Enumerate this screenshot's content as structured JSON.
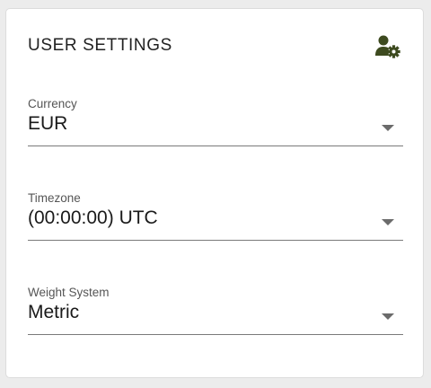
{
  "card": {
    "title": "USER SETTINGS",
    "header_icon": "user-settings-icon"
  },
  "fields": [
    {
      "label": "Currency",
      "value": "EUR"
    },
    {
      "label": "Timezone",
      "value": "(00:00:00) UTC"
    },
    {
      "label": "Weight System",
      "value": "Metric"
    }
  ],
  "colors": {
    "background": "#ececec",
    "card": "#ffffff",
    "icon": "#3d4a1f",
    "underline": "#7a7a7a",
    "caret": "#6b6b6b"
  }
}
